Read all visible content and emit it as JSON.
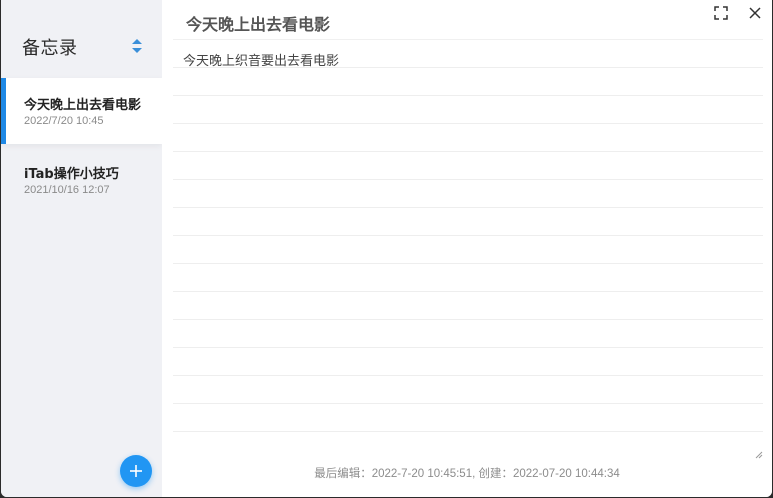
{
  "sidebar": {
    "title": "备忘录",
    "sort_icon": "sort-icon",
    "notes": [
      {
        "title": "今天晚上出去看电影",
        "date": "2022/7/20 10:45",
        "active": true
      },
      {
        "title": "iTab操作小技巧",
        "date": "2021/10/16 12:07",
        "active": false
      }
    ],
    "add_icon": "plus-icon"
  },
  "main": {
    "heading": "今天晚上出去看电影",
    "content": "今天晚上织音要出去看电影",
    "footer": "最后编辑：2022-7-20 10:45:51, 创建：2022-07-20 10:44:34",
    "controls": [
      "fullscreen-icon",
      "close-icon"
    ]
  },
  "colors": {
    "accent": "#2196f3",
    "active_bar": "#1e88e5",
    "sidebar_bg": "#f0f1f5"
  }
}
